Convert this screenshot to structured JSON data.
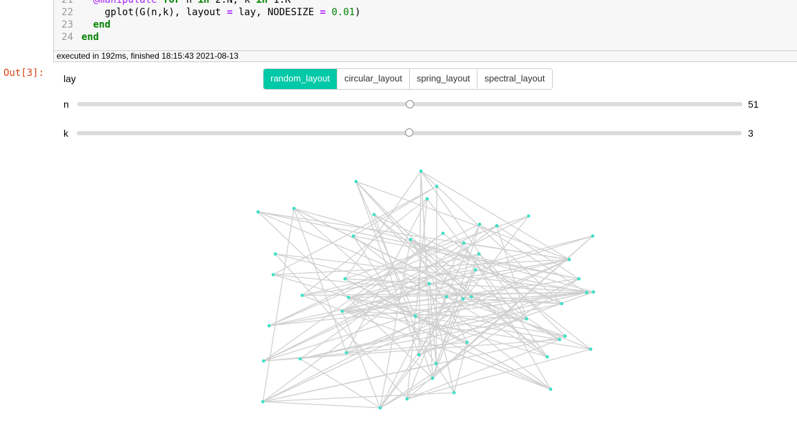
{
  "code": {
    "lines": [
      {
        "n": "21",
        "text": "  @manipulate for n in 2:N, k in 1:K"
      },
      {
        "n": "22",
        "text": "    gplot(G(n,k), layout = lay, NODESIZE = 0.01)"
      },
      {
        "n": "23",
        "text": "  end"
      },
      {
        "n": "24",
        "text": "end"
      }
    ],
    "exec_status": "executed in 192ms, finished 18:15:43 2021-08-13"
  },
  "output": {
    "prompt": "Out[3]:",
    "lay_label": "lay",
    "layout_options": [
      "random_layout",
      "circular_layout",
      "spring_layout",
      "spectral_layout"
    ],
    "selected_layout": "random_layout",
    "sliders": [
      {
        "label": "n",
        "value": "51",
        "fraction": 0.5
      },
      {
        "label": "k",
        "value": "3",
        "fraction": 0.5
      }
    ]
  },
  "colors": {
    "accent": "#00c9a7",
    "node": "#40e0c8",
    "edge": "#d0d0d0"
  }
}
